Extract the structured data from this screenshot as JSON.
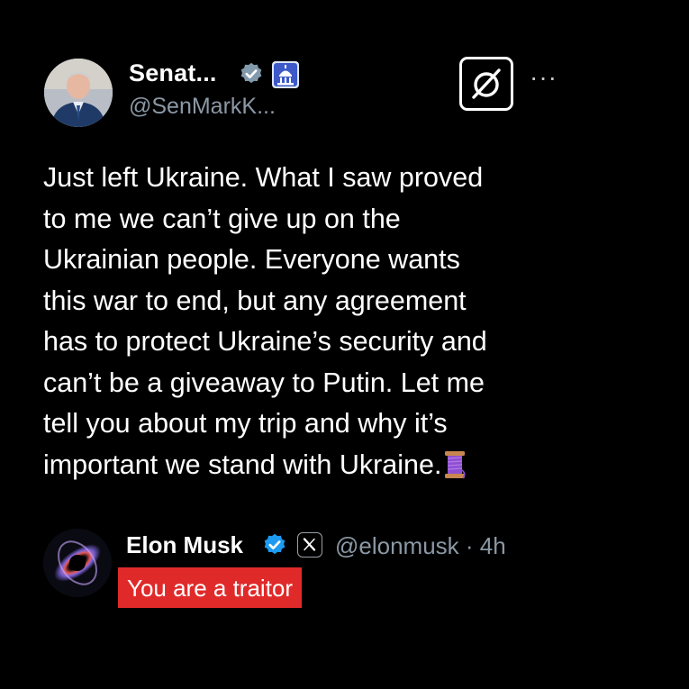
{
  "original_tweet": {
    "author_name": "Senat...",
    "handle": "@SenMarkK...",
    "avatar_icon": "senator-photo",
    "verified_icon": "verified-gray-badge-icon",
    "affiliation_icon": "capitol-building-icon",
    "grok_icon": "grok-icon",
    "more_icon": "more-icon",
    "more_label": "···",
    "lines": [
      "Just left Ukraine. What I saw proved",
      "to me we can’t give up on the",
      "Ukrainian people. Everyone wants",
      "this war to end, but any agreement",
      "has to protect Ukraine’s security and",
      "can’t be a giveaway to Putin. Let me",
      "tell you about my trip and why it’s",
      "important we stand with Ukraine."
    ],
    "thread_icon": "thread-spool-emoji"
  },
  "reply": {
    "author_name": "Elon Musk",
    "verified_icon": "verified-blue-badge-icon",
    "affiliation_icon": "x-logo-icon",
    "handle_time": "@elonmusk · 4h",
    "text": "You are a traitor",
    "highlight_color": "#e02a2a"
  }
}
